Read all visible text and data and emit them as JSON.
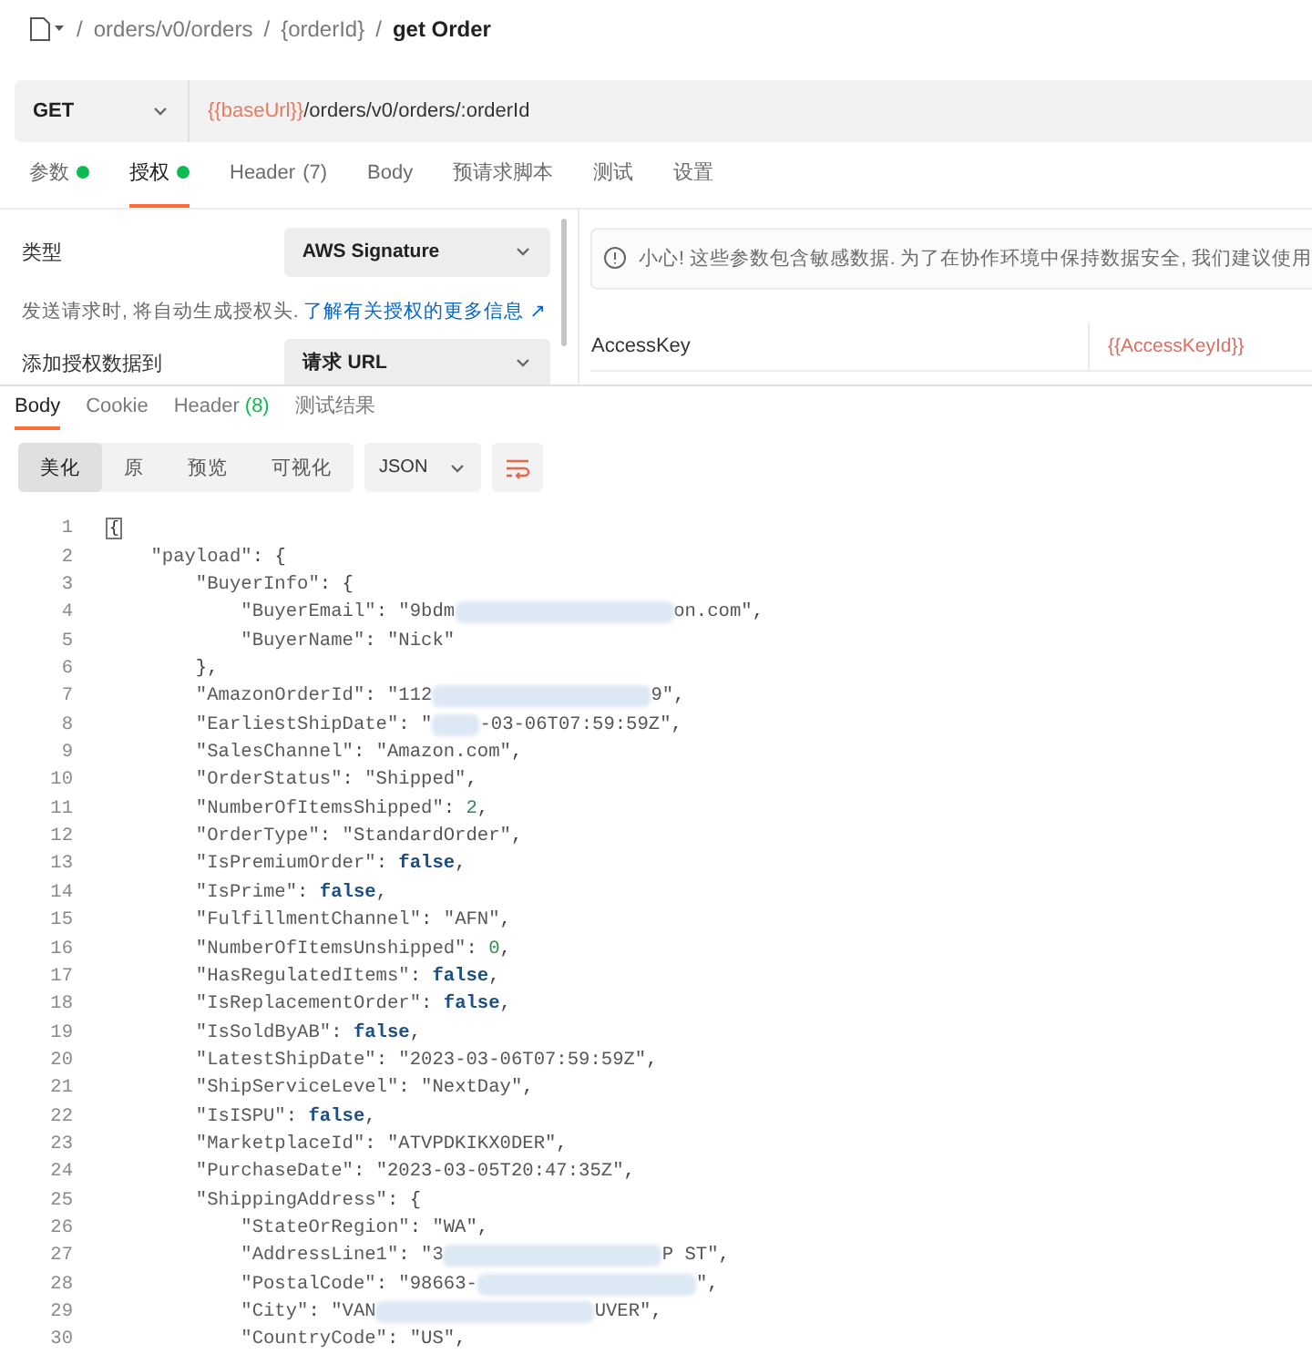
{
  "breadcrumb": {
    "items": [
      "orders/v0/orders",
      "{orderId}"
    ],
    "current": "get Order",
    "separator": "/"
  },
  "request": {
    "method": "GET",
    "url_variable": "{{baseUrl}}",
    "url_path": "/orders/v0/orders/:orderId"
  },
  "request_tabs": [
    {
      "label": "参数",
      "selected": false,
      "dot": true
    },
    {
      "label": "授权",
      "selected": true,
      "dot": true
    },
    {
      "label": "Header",
      "count": "(7)",
      "selected": false,
      "dot": false
    },
    {
      "label": "Body",
      "selected": false,
      "dot": false
    },
    {
      "label": "预请求脚本",
      "selected": false,
      "dot": false
    },
    {
      "label": "测试",
      "selected": false,
      "dot": false
    },
    {
      "label": "设置",
      "selected": false,
      "dot": false
    }
  ],
  "auth": {
    "type_label": "类型",
    "type_value": "AWS Signature",
    "hint": "发送请求时, 将自动生成授权头.",
    "hint_link": "了解有关授权的更多信息 ↗",
    "add_to_label": "添加授权数据到",
    "add_to_value": "请求 URL",
    "warning": "小心! 这些参数包含敏感数据. 为了在协作环境中保持数据安全, 我们建议使用",
    "access_key_label": "AccessKey",
    "access_key_value": "{{AccessKeyId}}"
  },
  "response_tabs": [
    {
      "label": "Body",
      "selected": true
    },
    {
      "label": "Cookie",
      "selected": false
    },
    {
      "label": "Header",
      "count": "(8)",
      "selected": false
    },
    {
      "label": "测试结果",
      "selected": false
    }
  ],
  "view_modes": [
    {
      "label": "美化",
      "selected": true
    },
    {
      "label": "原",
      "selected": false
    },
    {
      "label": "预览",
      "selected": false
    },
    {
      "label": "可视化",
      "selected": false
    }
  ],
  "format": "JSON",
  "code_lines": [
    {
      "n": "1",
      "tokens": [
        {
          "kind": "fold",
          "text": "{"
        }
      ]
    },
    {
      "n": "2",
      "tokens": [
        {
          "kind": "key",
          "text": "    \"payload\""
        },
        {
          "kind": "punct",
          "text": ": {"
        }
      ]
    },
    {
      "n": "3",
      "tokens": [
        {
          "kind": "key",
          "text": "        \"BuyerInfo\""
        },
        {
          "kind": "punct",
          "text": ": {"
        }
      ]
    },
    {
      "n": "4",
      "tokens": [
        {
          "kind": "key",
          "text": "            \"BuyerEmail\""
        },
        {
          "kind": "punct",
          "text": ": "
        },
        {
          "kind": "str",
          "text": "\"9bdm"
        },
        {
          "kind": "redaction"
        },
        {
          "kind": "str",
          "text": "on.com\""
        },
        {
          "kind": "punct",
          "text": ","
        }
      ]
    },
    {
      "n": "5",
      "tokens": [
        {
          "kind": "key",
          "text": "            \"BuyerName\""
        },
        {
          "kind": "punct",
          "text": ": "
        },
        {
          "kind": "str",
          "text": "\"Nick\""
        }
      ]
    },
    {
      "n": "6",
      "tokens": [
        {
          "kind": "punct",
          "text": "        },"
        }
      ]
    },
    {
      "n": "7",
      "tokens": [
        {
          "kind": "key",
          "text": "        \"AmazonOrderId\""
        },
        {
          "kind": "punct",
          "text": ": "
        },
        {
          "kind": "str",
          "text": "\"112"
        },
        {
          "kind": "redaction"
        },
        {
          "kind": "str",
          "text": "9\""
        },
        {
          "kind": "punct",
          "text": ","
        }
      ]
    },
    {
      "n": "8",
      "tokens": [
        {
          "kind": "key",
          "text": "        \"EarliestShipDate\""
        },
        {
          "kind": "punct",
          "text": ": "
        },
        {
          "kind": "str",
          "text": "\""
        },
        {
          "kind": "smudge"
        },
        {
          "kind": "str",
          "text": "-03-06T07:59:59Z\""
        },
        {
          "kind": "punct",
          "text": ","
        }
      ]
    },
    {
      "n": "9",
      "tokens": [
        {
          "kind": "key",
          "text": "        \"SalesChannel\""
        },
        {
          "kind": "punct",
          "text": ": "
        },
        {
          "kind": "str",
          "text": "\"Amazon.com\""
        },
        {
          "kind": "punct",
          "text": ","
        }
      ]
    },
    {
      "n": "10",
      "tokens": [
        {
          "kind": "key",
          "text": "        \"OrderStatus\""
        },
        {
          "kind": "punct",
          "text": ": "
        },
        {
          "kind": "str",
          "text": "\"Shipped\""
        },
        {
          "kind": "punct",
          "text": ","
        }
      ]
    },
    {
      "n": "11",
      "tokens": [
        {
          "kind": "key",
          "text": "        \"NumberOfItemsShipped\""
        },
        {
          "kind": "punct",
          "text": ": "
        },
        {
          "kind": "num",
          "text": "2"
        },
        {
          "kind": "punct",
          "text": ","
        }
      ]
    },
    {
      "n": "12",
      "tokens": [
        {
          "kind": "key",
          "text": "        \"OrderType\""
        },
        {
          "kind": "punct",
          "text": ": "
        },
        {
          "kind": "str",
          "text": "\"StandardOrder\""
        },
        {
          "kind": "punct",
          "text": ","
        }
      ]
    },
    {
      "n": "13",
      "tokens": [
        {
          "kind": "key",
          "text": "        \"IsPremiumOrder\""
        },
        {
          "kind": "punct",
          "text": ": "
        },
        {
          "kind": "bool",
          "text": "false"
        },
        {
          "kind": "punct",
          "text": ","
        }
      ]
    },
    {
      "n": "14",
      "tokens": [
        {
          "kind": "key",
          "text": "        \"IsPrime\""
        },
        {
          "kind": "punct",
          "text": ": "
        },
        {
          "kind": "bool",
          "text": "false"
        },
        {
          "kind": "punct",
          "text": ","
        }
      ]
    },
    {
      "n": "15",
      "tokens": [
        {
          "kind": "key",
          "text": "        \"FulfillmentChannel\""
        },
        {
          "kind": "punct",
          "text": ": "
        },
        {
          "kind": "str",
          "text": "\"AFN\""
        },
        {
          "kind": "punct",
          "text": ","
        }
      ]
    },
    {
      "n": "16",
      "tokens": [
        {
          "kind": "key",
          "text": "        \"NumberOfItemsUnshipped\""
        },
        {
          "kind": "punct",
          "text": ": "
        },
        {
          "kind": "num",
          "text": "0"
        },
        {
          "kind": "punct",
          "text": ","
        }
      ]
    },
    {
      "n": "17",
      "tokens": [
        {
          "kind": "key",
          "text": "        \"HasRegulatedItems\""
        },
        {
          "kind": "punct",
          "text": ": "
        },
        {
          "kind": "bool",
          "text": "false"
        },
        {
          "kind": "punct",
          "text": ","
        }
      ]
    },
    {
      "n": "18",
      "tokens": [
        {
          "kind": "key",
          "text": "        \"IsReplacementOrder\""
        },
        {
          "kind": "punct",
          "text": ": "
        },
        {
          "kind": "bool",
          "text": "false"
        },
        {
          "kind": "punct",
          "text": ","
        }
      ]
    },
    {
      "n": "19",
      "tokens": [
        {
          "kind": "key",
          "text": "        \"IsSoldByAB\""
        },
        {
          "kind": "punct",
          "text": ": "
        },
        {
          "kind": "bool",
          "text": "false"
        },
        {
          "kind": "punct",
          "text": ","
        }
      ]
    },
    {
      "n": "20",
      "tokens": [
        {
          "kind": "key",
          "text": "        \"LatestShipDate\""
        },
        {
          "kind": "punct",
          "text": ": "
        },
        {
          "kind": "str",
          "text": "\"2023-03-06T07:59:59Z\""
        },
        {
          "kind": "punct",
          "text": ","
        }
      ]
    },
    {
      "n": "21",
      "tokens": [
        {
          "kind": "key",
          "text": "        \"ShipServiceLevel\""
        },
        {
          "kind": "punct",
          "text": ": "
        },
        {
          "kind": "str",
          "text": "\"NextDay\""
        },
        {
          "kind": "punct",
          "text": ","
        }
      ]
    },
    {
      "n": "22",
      "tokens": [
        {
          "kind": "key",
          "text": "        \"IsISPU\""
        },
        {
          "kind": "punct",
          "text": ": "
        },
        {
          "kind": "bool",
          "text": "false"
        },
        {
          "kind": "punct",
          "text": ","
        }
      ]
    },
    {
      "n": "23",
      "tokens": [
        {
          "kind": "key",
          "text": "        \"MarketplaceId\""
        },
        {
          "kind": "punct",
          "text": ": "
        },
        {
          "kind": "str",
          "text": "\"ATVPDKIKX0DER\""
        },
        {
          "kind": "punct",
          "text": ","
        }
      ]
    },
    {
      "n": "24",
      "tokens": [
        {
          "kind": "key",
          "text": "        \"PurchaseDate\""
        },
        {
          "kind": "punct",
          "text": ": "
        },
        {
          "kind": "str",
          "text": "\"2023-03-05T20:47:35Z\""
        },
        {
          "kind": "punct",
          "text": ","
        }
      ]
    },
    {
      "n": "25",
      "tokens": [
        {
          "kind": "key",
          "text": "        \"ShippingAddress\""
        },
        {
          "kind": "punct",
          "text": ": {"
        }
      ]
    },
    {
      "n": "26",
      "tokens": [
        {
          "kind": "key",
          "text": "            \"StateOrRegion\""
        },
        {
          "kind": "punct",
          "text": ": "
        },
        {
          "kind": "str",
          "text": "\"WA\""
        },
        {
          "kind": "punct",
          "text": ","
        }
      ]
    },
    {
      "n": "27",
      "tokens": [
        {
          "kind": "key",
          "text": "            \"AddressLine1\""
        },
        {
          "kind": "punct",
          "text": ": "
        },
        {
          "kind": "str",
          "text": "\"3"
        },
        {
          "kind": "redaction"
        },
        {
          "kind": "str",
          "text": "P ST\""
        },
        {
          "kind": "punct",
          "text": ","
        }
      ]
    },
    {
      "n": "28",
      "tokens": [
        {
          "kind": "key",
          "text": "            \"PostalCode\""
        },
        {
          "kind": "punct",
          "text": ": "
        },
        {
          "kind": "str",
          "text": "\"98663-"
        },
        {
          "kind": "redaction"
        },
        {
          "kind": "str",
          "text": "\""
        },
        {
          "kind": "punct",
          "text": ","
        }
      ]
    },
    {
      "n": "29",
      "tokens": [
        {
          "kind": "key",
          "text": "            \"City\""
        },
        {
          "kind": "punct",
          "text": ": "
        },
        {
          "kind": "str",
          "text": "\"VAN"
        },
        {
          "kind": "redaction"
        },
        {
          "kind": "str",
          "text": "UVER\""
        },
        {
          "kind": "punct",
          "text": ","
        }
      ]
    },
    {
      "n": "30",
      "tokens": [
        {
          "kind": "key",
          "text": "            \"CountryCode\""
        },
        {
          "kind": "punct",
          "text": ": "
        },
        {
          "kind": "str",
          "text": "\"US\""
        },
        {
          "kind": "punct",
          "text": ","
        }
      ]
    }
  ]
}
